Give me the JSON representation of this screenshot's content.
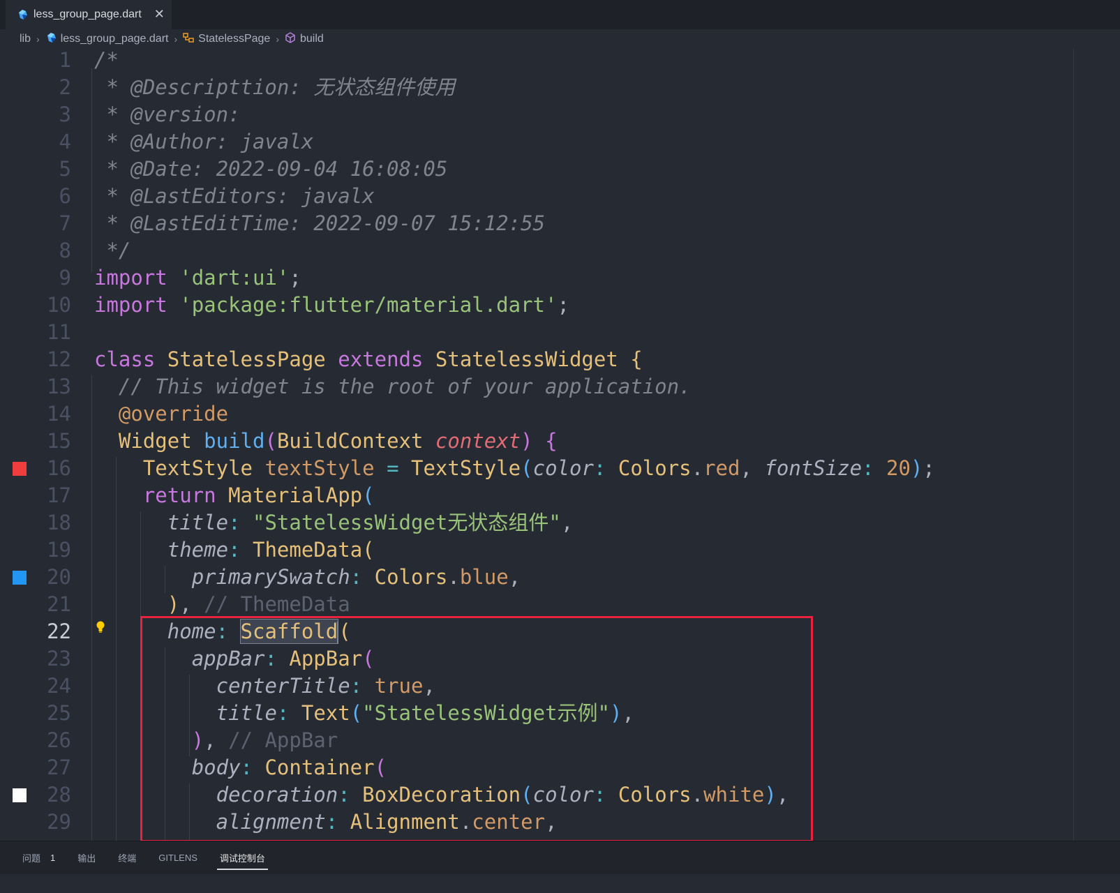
{
  "tab": {
    "filename": "less_group_page.dart",
    "icon": "dart-file-icon"
  },
  "breadcrumb": {
    "folder": "lib",
    "file": "less_group_page.dart",
    "class": "StatelessPage",
    "method": "build"
  },
  "editor": {
    "active_line": 22,
    "line_numbers": [
      "1",
      "2",
      "3",
      "4",
      "5",
      "6",
      "7",
      "8",
      "9",
      "10",
      "11",
      "12",
      "13",
      "14",
      "15",
      "16",
      "17",
      "18",
      "19",
      "20",
      "21",
      "22",
      "23",
      "24",
      "25",
      "26",
      "27",
      "28",
      "29"
    ],
    "comment": {
      "l1": "/*",
      "l2": " * @Descripttion: 无状态组件使用",
      "l3": " * @version:",
      "l4": " * @Author: javalx",
      "l5": " * @Date: 2022-09-04 16:08:05",
      "l6": " * @LastEditors: javalx",
      "l7": " * @LastEditTime: 2022-09-07 15:12:55",
      "l8": " */"
    },
    "imports": {
      "kw": "import",
      "dart_ui": "'dart:ui'",
      "material": "'package:flutter/material.dart'",
      "semi": ";"
    },
    "class_decl": {
      "kw_class": "class",
      "name": "StatelessPage",
      "kw_extends": "extends",
      "super": "StatelessWidget",
      "brace": "{"
    },
    "l13": "// This widget is the root of your application.",
    "l14": "@override",
    "l15": {
      "ret": "Widget",
      "fn": "build",
      "ptype": "BuildContext",
      "pname": "context"
    },
    "l16": {
      "type": "TextStyle",
      "var": "textStyle",
      "ctor": "TextStyle",
      "arg1": "color",
      "cls": "Colors",
      "val1": "red",
      "arg2": "fontSize",
      "num": "20"
    },
    "l17": {
      "kw": "return",
      "cls": "MaterialApp"
    },
    "l18": {
      "arg": "title",
      "str": "\"StatelessWidget无状态组件\""
    },
    "l19": {
      "arg": "theme",
      "cls": "ThemeData"
    },
    "l20": {
      "arg": "primarySwatch",
      "cls": "Colors",
      "val": "blue"
    },
    "l21": {
      "hint": "// ThemeData"
    },
    "l22": {
      "arg": "home",
      "cls": "Scaffold"
    },
    "l23": {
      "arg": "appBar",
      "cls": "AppBar"
    },
    "l24": {
      "arg": "centerTitle",
      "val": "true"
    },
    "l25": {
      "arg": "title",
      "cls": "Text",
      "str": "\"StatelessWidget示例\""
    },
    "l26": {
      "hint": "// AppBar"
    },
    "l27": {
      "arg": "body",
      "cls": "Container"
    },
    "l28": {
      "arg": "decoration",
      "cls": "BoxDecoration",
      "arg2": "color",
      "cls2": "Colors",
      "val": "white"
    },
    "l29": {
      "arg": "alignment",
      "cls": "Alignment",
      "val": "center"
    },
    "color_markers": {
      "line16": "#f03e3e",
      "line20": "#2196f3",
      "line28": "#ffffff"
    }
  },
  "panel": {
    "tabs": [
      {
        "label": "问题",
        "badge": "1"
      },
      {
        "label": "输出"
      },
      {
        "label": "终端"
      },
      {
        "label": "GITLENS"
      },
      {
        "label": "调试控制台",
        "active": true
      }
    ]
  }
}
